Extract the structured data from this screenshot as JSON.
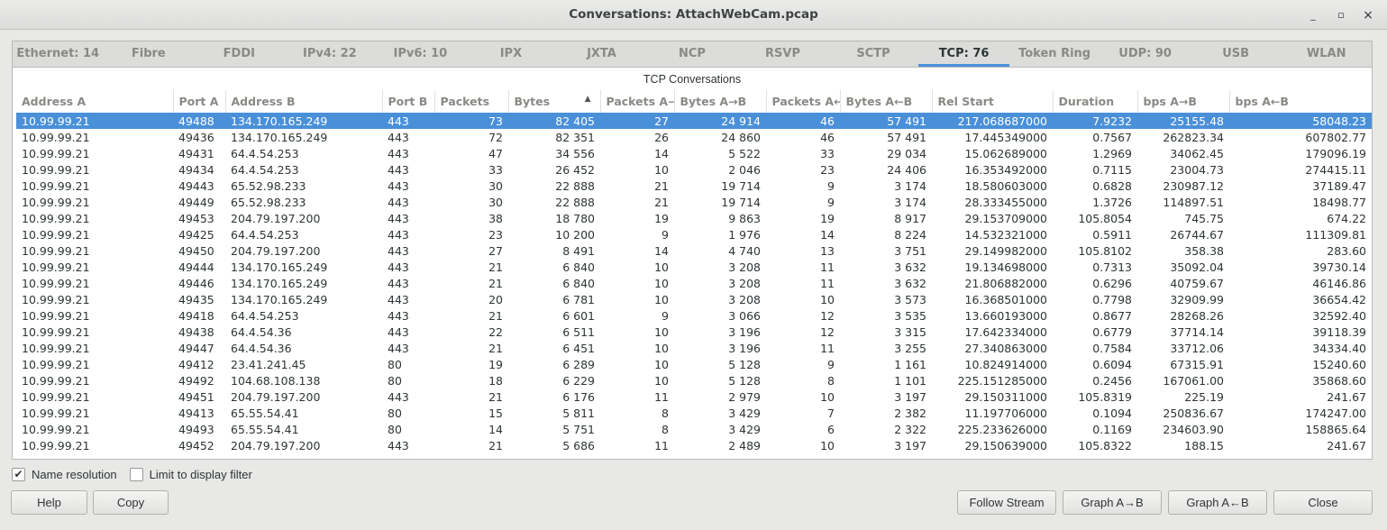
{
  "window": {
    "title": "Conversations: AttachWebCam.pcap",
    "controls": [
      "_",
      "▫",
      "×"
    ]
  },
  "tabs": [
    "Ethernet: 14",
    "Fibre Channel",
    "FDDI",
    "IPv4: 22",
    "IPv6: 10",
    "IPX",
    "JXTA",
    "NCP",
    "RSVP",
    "SCTP",
    "TCP: 76",
    "Token Ring",
    "UDP: 90",
    "USB",
    "WLAN"
  ],
  "active_tab": "TCP: 76",
  "table": {
    "caption": "TCP Conversations",
    "sorted_column": "Bytes",
    "columns": [
      "Address A",
      "Port A",
      "Address B",
      "Port B",
      "Packets",
      "Bytes",
      "Packets A→B",
      "Bytes A→B",
      "Packets A←B",
      "Bytes A←B",
      "Rel Start",
      "Duration",
      "bps A→B",
      "bps A←B"
    ],
    "rows": [
      [
        "10.99.99.21",
        "49488",
        "134.170.165.249",
        "443",
        "73",
        "82 405",
        "27",
        "24 914",
        "46",
        "57 491",
        "217.068687000",
        "7.9232",
        "25155.48",
        "58048.23"
      ],
      [
        "10.99.99.21",
        "49436",
        "134.170.165.249",
        "443",
        "72",
        "82 351",
        "26",
        "24 860",
        "46",
        "57 491",
        "17.445349000",
        "0.7567",
        "262823.34",
        "607802.77"
      ],
      [
        "10.99.99.21",
        "49431",
        "64.4.54.253",
        "443",
        "47",
        "34 556",
        "14",
        "5 522",
        "33",
        "29 034",
        "15.062689000",
        "1.2969",
        "34062.45",
        "179096.19"
      ],
      [
        "10.99.99.21",
        "49434",
        "64.4.54.253",
        "443",
        "33",
        "26 452",
        "10",
        "2 046",
        "23",
        "24 406",
        "16.353492000",
        "0.7115",
        "23004.73",
        "274415.11"
      ],
      [
        "10.99.99.21",
        "49443",
        "65.52.98.233",
        "443",
        "30",
        "22 888",
        "21",
        "19 714",
        "9",
        "3 174",
        "18.580603000",
        "0.6828",
        "230987.12",
        "37189.47"
      ],
      [
        "10.99.99.21",
        "49449",
        "65.52.98.233",
        "443",
        "30",
        "22 888",
        "21",
        "19 714",
        "9",
        "3 174",
        "28.333455000",
        "1.3726",
        "114897.51",
        "18498.77"
      ],
      [
        "10.99.99.21",
        "49453",
        "204.79.197.200",
        "443",
        "38",
        "18 780",
        "19",
        "9 863",
        "19",
        "8 917",
        "29.153709000",
        "105.8054",
        "745.75",
        "674.22"
      ],
      [
        "10.99.99.21",
        "49425",
        "64.4.54.253",
        "443",
        "23",
        "10 200",
        "9",
        "1 976",
        "14",
        "8 224",
        "14.532321000",
        "0.5911",
        "26744.67",
        "111309.81"
      ],
      [
        "10.99.99.21",
        "49450",
        "204.79.197.200",
        "443",
        "27",
        "8 491",
        "14",
        "4 740",
        "13",
        "3 751",
        "29.149982000",
        "105.8102",
        "358.38",
        "283.60"
      ],
      [
        "10.99.99.21",
        "49444",
        "134.170.165.249",
        "443",
        "21",
        "6 840",
        "10",
        "3 208",
        "11",
        "3 632",
        "19.134698000",
        "0.7313",
        "35092.04",
        "39730.14"
      ],
      [
        "10.99.99.21",
        "49446",
        "134.170.165.249",
        "443",
        "21",
        "6 840",
        "10",
        "3 208",
        "11",
        "3 632",
        "21.806882000",
        "0.6296",
        "40759.67",
        "46146.86"
      ],
      [
        "10.99.99.21",
        "49435",
        "134.170.165.249",
        "443",
        "20",
        "6 781",
        "10",
        "3 208",
        "10",
        "3 573",
        "16.368501000",
        "0.7798",
        "32909.99",
        "36654.42"
      ],
      [
        "10.99.99.21",
        "49418",
        "64.4.54.253",
        "443",
        "21",
        "6 601",
        "9",
        "3 066",
        "12",
        "3 535",
        "13.660193000",
        "0.8677",
        "28268.26",
        "32592.40"
      ],
      [
        "10.99.99.21",
        "49438",
        "64.4.54.36",
        "443",
        "22",
        "6 511",
        "10",
        "3 196",
        "12",
        "3 315",
        "17.642334000",
        "0.6779",
        "37714.14",
        "39118.39"
      ],
      [
        "10.99.99.21",
        "49447",
        "64.4.54.36",
        "443",
        "21",
        "6 451",
        "10",
        "3 196",
        "11",
        "3 255",
        "27.340863000",
        "0.7584",
        "33712.06",
        "34334.40"
      ],
      [
        "10.99.99.21",
        "49412",
        "23.41.241.45",
        "80",
        "19",
        "6 289",
        "10",
        "5 128",
        "9",
        "1 161",
        "10.824914000",
        "0.6094",
        "67315.91",
        "15240.60"
      ],
      [
        "10.99.99.21",
        "49492",
        "104.68.108.138",
        "80",
        "18",
        "6 229",
        "10",
        "5 128",
        "8",
        "1 101",
        "225.151285000",
        "0.2456",
        "167061.00",
        "35868.60"
      ],
      [
        "10.99.99.21",
        "49451",
        "204.79.197.200",
        "443",
        "21",
        "6 176",
        "11",
        "2 979",
        "10",
        "3 197",
        "29.150311000",
        "105.8319",
        "225.19",
        "241.67"
      ],
      [
        "10.99.99.21",
        "49413",
        "65.55.54.41",
        "80",
        "15",
        "5 811",
        "8",
        "3 429",
        "7",
        "2 382",
        "11.197706000",
        "0.1094",
        "250836.67",
        "174247.00"
      ],
      [
        "10.99.99.21",
        "49493",
        "65.55.54.41",
        "80",
        "14",
        "5 751",
        "8",
        "3 429",
        "6",
        "2 322",
        "225.233626000",
        "0.1169",
        "234603.90",
        "158865.64"
      ],
      [
        "10.99.99.21",
        "49452",
        "204.79.197.200",
        "443",
        "21",
        "5 686",
        "11",
        "2 489",
        "10",
        "3 197",
        "29.150639000",
        "105.8322",
        "188.15",
        "241.67"
      ]
    ]
  },
  "options": {
    "name_resolution": "Name resolution",
    "name_resolution_checked": true,
    "limit_filter": "Limit to display filter",
    "limit_filter_checked": false
  },
  "buttons": {
    "help": "Help",
    "copy": "Copy",
    "follow_stream": "Follow Stream",
    "graph_ab": "Graph A→B",
    "graph_ba": "Graph A←B",
    "close": "Close"
  },
  "colors": {
    "selection": "#4a90d9",
    "tab_indicator": "#4a90d9"
  }
}
